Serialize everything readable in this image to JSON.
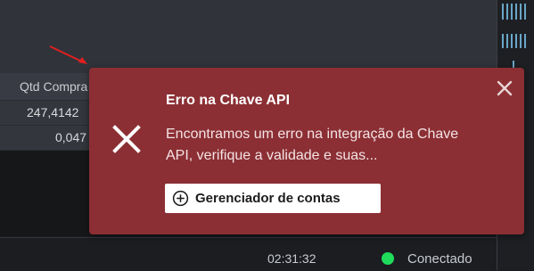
{
  "table": {
    "column_header": "Qtd Compra",
    "rows": [
      "247,4142",
      "0,047"
    ]
  },
  "toast": {
    "title": "Erro na Chave API",
    "message": "Encontramos um erro na integração da Chave API, verifique a validade e suas...",
    "button_label": "Gerenciador de contas",
    "background_color": "#8b2f34"
  },
  "status": {
    "time": "02:31:32",
    "connection": "Conectado",
    "connection_color": "#1fdc5a"
  },
  "icons": [
    "error-x-icon",
    "close-icon",
    "add-circle-icon"
  ]
}
